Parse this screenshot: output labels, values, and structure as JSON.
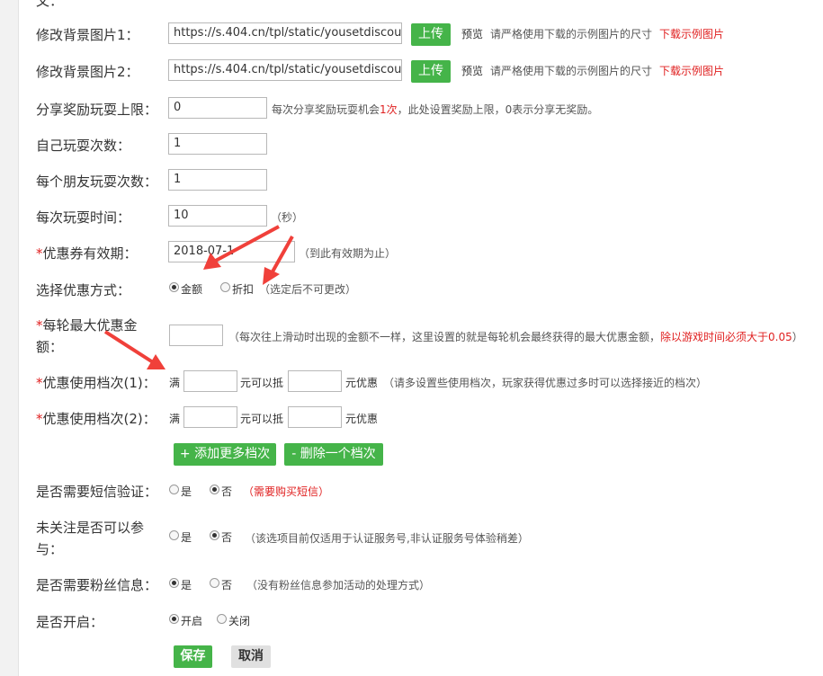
{
  "form": {
    "bg1": {
      "label": "修改背景图片1：",
      "value": "https://s.404.cn/tpl/static/yousetdiscount/in",
      "upload": "上传",
      "preview": "预览",
      "note": "请严格使用下载的示例图片的尺寸",
      "download": "下载示例图片"
    },
    "bg2": {
      "label": "修改背景图片2：",
      "value": "https://s.404.cn/tpl/static/yousetdiscount/in",
      "upload": "上传",
      "preview": "预览",
      "note": "请严格使用下载的示例图片的尺寸",
      "download": "下载示例图片"
    },
    "share": {
      "label": "分享奖励玩耍上限：",
      "value": "0",
      "hint_pre": "每次分享奖励玩耍机会",
      "hint_num": "1次",
      "hint_post": "，此处设置奖励上限，0表示分享无奖励。"
    },
    "self_plays": {
      "label": "自己玩耍次数：",
      "value": "1"
    },
    "friend_plays": {
      "label": "每个朋友玩耍次数：",
      "value": "1"
    },
    "play_time": {
      "label": "每次玩耍时间：",
      "value": "10",
      "unit": "（秒）"
    },
    "validity": {
      "star": "*",
      "label": "优惠券有效期：",
      "value": "2018-07-1",
      "hint": "（到此有效期为止）"
    },
    "discount_mode": {
      "label": "选择优惠方式：",
      "opt1": "金额",
      "opt2": "折扣",
      "hint": "（选定后不可更改）",
      "selected": "金额"
    },
    "max_amount": {
      "star": "*",
      "label_line1": "每轮最大优惠金",
      "label_line2": "额：",
      "value": "",
      "hint": "（每次往上滑动时出现的金额不一样，这里设置的就是每轮机会最终获得的最大优惠金额，",
      "hint_red": "除以游戏时间必须大于0.05",
      "hint_end": "）"
    },
    "tier1": {
      "star": "*",
      "label": "优惠使用档次(1)：",
      "full": "满",
      "mid": "元可以抵",
      "end": "元优惠",
      "hint": "（请多设置些使用档次，玩家获得优惠过多时可以选择接近的档次）"
    },
    "tier2": {
      "star": "*",
      "label": "优惠使用档次(2)：",
      "full": "满",
      "mid": "元可以抵",
      "end": "元优惠"
    },
    "add_tier": "+ 添加更多档次",
    "remove_tier": "- 删除一个档次",
    "sms": {
      "label": "是否需要短信验证：",
      "yes": "是",
      "no": "否",
      "hint": "（需要购买短信）",
      "selected": "否"
    },
    "follow": {
      "label_line1": "未关注是否可以参",
      "label_line2": "与：",
      "yes": "是",
      "no": "否",
      "hint": "（该选项目前仅适用于认证服务号,非认证服务号体验稍差）",
      "selected": "否"
    },
    "fans": {
      "label": "是否需要粉丝信息：",
      "yes": "是",
      "no": "否",
      "hint": "（没有粉丝信息参加活动的处理方式）",
      "selected": "是"
    },
    "enable": {
      "label": "是否开启：",
      "on": "开启",
      "off": "关闭",
      "selected": "开启"
    },
    "save": "保存",
    "cancel": "取消"
  },
  "colors": {
    "green": "#45b449",
    "red": "#e02020",
    "arrow": "#f0403a"
  }
}
